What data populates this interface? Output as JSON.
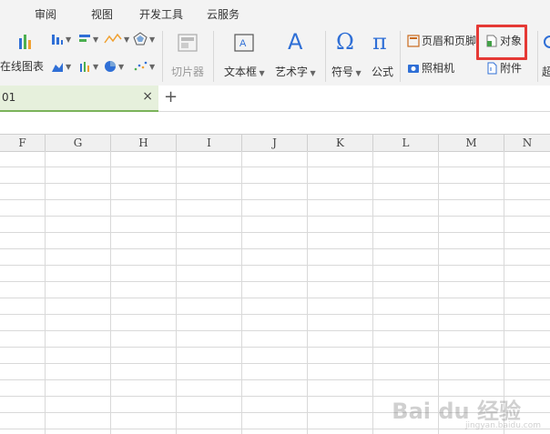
{
  "menu": [
    "审阅",
    "视图",
    "开发工具",
    "云服务"
  ],
  "ribbon": {
    "online_chart": "在线图表",
    "slicer": "切片器",
    "textbox": "文本框",
    "wordart": "艺术字",
    "symbol": "符号",
    "formula": "公式",
    "header_footer": "页眉和页脚",
    "object": "对象",
    "camera": "照相机",
    "attachment": "附件",
    "super": "超"
  },
  "tabs": {
    "sheet_label": "01",
    "close": "×",
    "add": "+"
  },
  "columns": [
    "F",
    "G",
    "H",
    "I",
    "J",
    "K",
    "L",
    "M",
    "N"
  ],
  "colors": {
    "highlight": "#e53935",
    "sheet_tab_bg": "#e6f0dc",
    "sheet_tab_accent": "#7bb35a",
    "accent_blue": "#2f6fd6"
  },
  "watermark": {
    "text": "Bai du 经验",
    "sub": "jingyan.baidu.com"
  }
}
